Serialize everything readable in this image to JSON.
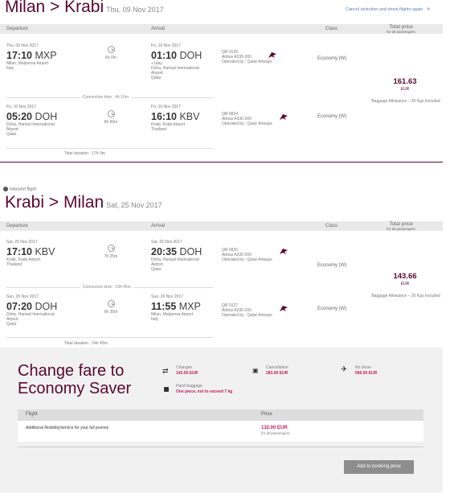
{
  "colors": {
    "brand": "#5c0632",
    "accent": "#c2185b",
    "link": "#5a7dbf",
    "button": "#8d8d8d"
  },
  "cancel_link": "Cancel selection and show flights again",
  "columns": {
    "departure": "Departure",
    "arrival": "Arrival",
    "class": "Class",
    "total_price": "Total price",
    "for_all": "for all passengers"
  },
  "outbound": {
    "route": "Milan > Krabi",
    "date": "Thu, 09 Nov 2017",
    "legs": [
      {
        "dep_date": "Thu, 09 Nov 2017",
        "dep_time": "17:10",
        "dep_code": "MXP",
        "dep_airport": [
          "Milan, Malpensa Airport",
          "Italy"
        ],
        "duration": "6h 0m",
        "arr_date": "Fri, 10 Nov 2017",
        "arr_time": "01:10",
        "arr_code": "DOH",
        "arr_note": "+1day",
        "arr_airport": [
          "Doha, Hamad International",
          "Airport",
          "Qatar"
        ],
        "flight_no": "QR 0128",
        "aircraft": "Airbus A330-200",
        "operated": "Operated by : Qatar Airways",
        "class": "Economy (W)"
      },
      {
        "dep_date": "Fri, 10 Nov 2017",
        "dep_time": "05:20",
        "dep_code": "DOH",
        "dep_airport": [
          "Doha, Hamad International",
          "Airport",
          "Qatar"
        ],
        "duration": "6h 50m",
        "arr_date": "Fri, 10 Nov 2017",
        "arr_time": "16:10",
        "arr_code": "KBV",
        "arr_airport": [
          "Krabi, Krabi Airport",
          "Thailand"
        ],
        "flight_no": "QR 0824",
        "aircraft": "Airbus A330-200",
        "operated": "Operated by : Qatar Airways",
        "class": "Economy (W)"
      }
    ],
    "connection": "Connection time : 4h 10m",
    "total_duration": "Total duration : 17h 0m",
    "price": "161.63",
    "currency": "EUR",
    "baggage": "Baggage Allowance – 30 Kgs Included"
  },
  "inbound_label": "Inbound flight",
  "inbound": {
    "route": "Krabi > Milan",
    "date": "Sat, 25 Nov 2017",
    "legs": [
      {
        "dep_date": "Sat, 25 Nov 2017",
        "dep_time": "17:10",
        "dep_code": "KBV",
        "dep_airport": [
          "Krabi, Krabi Airport",
          "Thailand"
        ],
        "duration": "7h 25m",
        "arr_date": "Sat, 25 Nov 2017",
        "arr_time": "20:35",
        "arr_code": "DOH",
        "arr_airport": [
          "Doha, Hamad International",
          "Airport",
          "Qatar"
        ],
        "flight_no": "QR 0825",
        "aircraft": "Airbus A330-200",
        "operated": "Operated by : Qatar Airways",
        "class": "Economy (W)"
      },
      {
        "dep_date": "Sun, 26 Nov 2017",
        "dep_time": "07:20",
        "dep_code": "DOH",
        "dep_airport": [
          "Doha, Hamad International",
          "Airport",
          "Qatar"
        ],
        "duration": "6h 35m",
        "arr_date": "Sun, 26 Nov 2017",
        "arr_time": "11:55",
        "arr_code": "MXP",
        "arr_airport": [
          "Milan, Malpensa Airport",
          "Italy"
        ],
        "flight_no": "QR 0127",
        "aircraft": "Airbus A330-200",
        "operated": "Operated by : Qatar Airways",
        "class": "Economy (W)"
      }
    ],
    "connection": "Connection time : 10h 45m",
    "total_duration": "Total duration : 24h 45m",
    "price": "143.66",
    "currency": "EUR",
    "baggage": "Baggage Allowance – 30 Kgs Included"
  },
  "fare": {
    "title_line1": "Change fare to",
    "title_line2": "Economy Saver",
    "changes_label": "Changes",
    "changes_value": "142.00 EUR",
    "cancellation_label": "Cancellation",
    "cancellation_value": "283.00 EUR",
    "noshow_label": "No show",
    "noshow_value": "566.00 EUR",
    "hand_baggage_label": "Hand baggage",
    "hand_baggage_value": "One piece, not to exceed 7 kg",
    "table_flight": "Flight",
    "table_price": "Price",
    "row_text": "Additional flexibility/service for your full journey",
    "row_price": "132.00 EUR",
    "row_price_sub": "for all passengers",
    "cta": "Add to booking price"
  }
}
